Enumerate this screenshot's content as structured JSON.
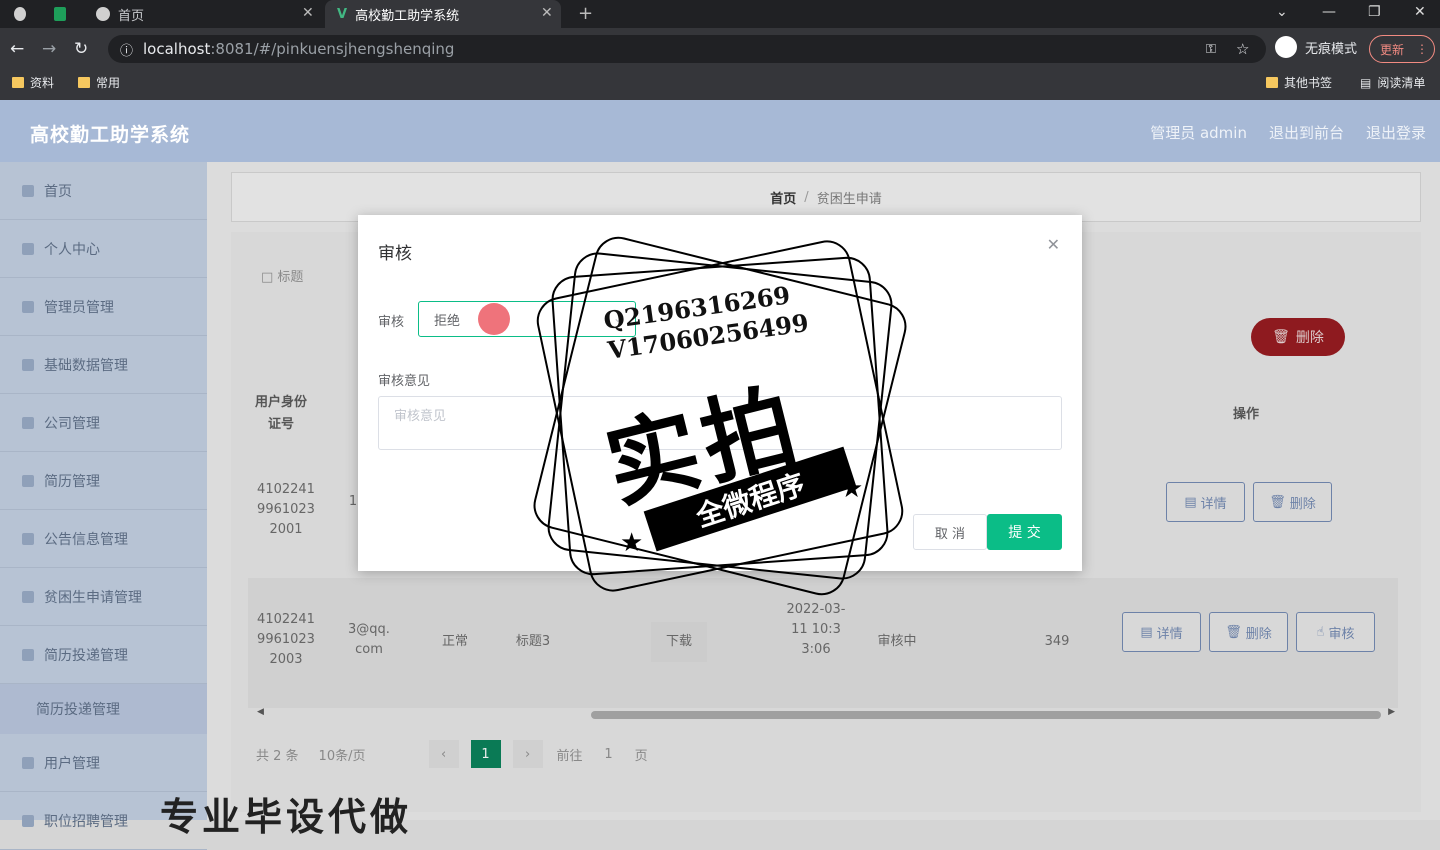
{
  "browser": {
    "tabs": [
      {
        "label": "首页"
      },
      {
        "label": "高校勤工助学系统"
      }
    ],
    "url_host": "localhost",
    "url_port": ":8081",
    "url_path": "/#/pinkuensjhengshenqing",
    "incognito_label": "无痕模式",
    "update_label": "更新",
    "bookmarks": [
      {
        "label": "资料"
      },
      {
        "label": "常用"
      }
    ],
    "bookmarks_right": [
      {
        "label": "其他书签"
      },
      {
        "label": "阅读清单"
      }
    ]
  },
  "app": {
    "title": "高校勤工助学系统",
    "user_links": [
      "管理员 admin",
      "退出到前台",
      "退出登录"
    ],
    "sidebar": [
      {
        "label": "首页"
      },
      {
        "label": "个人中心"
      },
      {
        "label": "管理员管理"
      },
      {
        "label": "基础数据管理"
      },
      {
        "label": "公司管理"
      },
      {
        "label": "简历管理"
      },
      {
        "label": "公告信息管理"
      },
      {
        "label": "贫困生申请管理"
      },
      {
        "label": "简历投递管理"
      },
      {
        "label": "简历投递管理",
        "sub": true
      },
      {
        "label": "用户管理"
      },
      {
        "label": "职位招聘管理"
      }
    ],
    "breadcrumb": {
      "home": "首页",
      "sep": "/",
      "current": "贫困生申请"
    },
    "search_label": "□ 标题",
    "delete_all_label": "删除",
    "table": {
      "headers": {
        "id_card": "用户身份证号",
        "actions": "操作"
      },
      "rows": [
        {
          "id_card": "410224199610232001",
          "email_frag": "1",
          "actions": [
            "详情",
            "删除"
          ]
        },
        {
          "id_card": "410224199610232003",
          "email": "3@qq.com",
          "status": "正常",
          "title": "标题3",
          "file": "下载",
          "time": "2022-03-11 10:33:06",
          "audit": "审核中",
          "num": "349",
          "actions": [
            "详情",
            "删除",
            "审核"
          ]
        }
      ]
    },
    "pager": {
      "total": "共 2 条",
      "size": "10条/页",
      "current": "1",
      "goto": "前往",
      "goto_value": "1",
      "page_unit": "页"
    }
  },
  "modal": {
    "title": "审核",
    "audit_label": "审核",
    "audit_value": "拒绝",
    "opinion_label": "审核意见",
    "opinion_placeholder": "审核意见",
    "cancel_label": "取 消",
    "submit_label": "提 交"
  },
  "watermark": {
    "line1": "Q2196316269",
    "line2": "V17060256499",
    "big": "实拍",
    "band": "全微程序",
    "bottom": "专业毕设代做"
  }
}
